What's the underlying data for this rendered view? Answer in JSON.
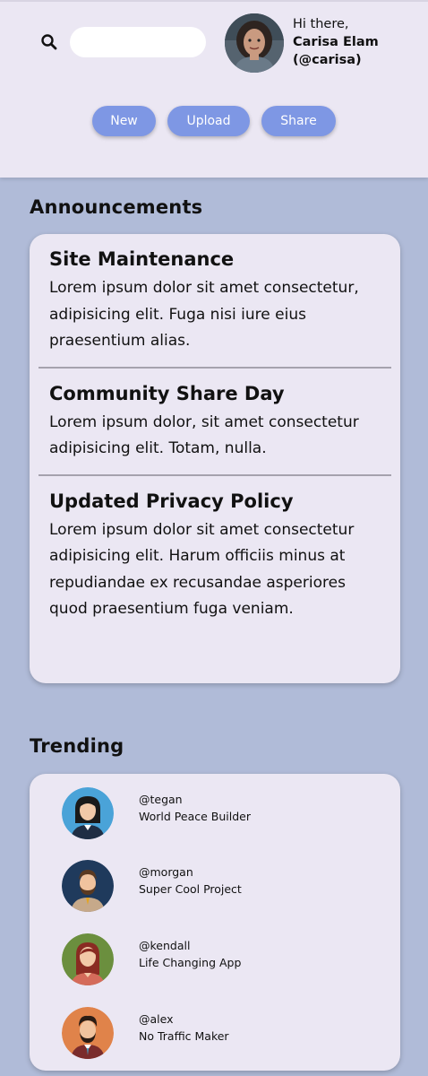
{
  "header": {
    "search": {
      "placeholder": "",
      "value": "",
      "icon": "search-icon"
    },
    "greeting_line": "Hi there,",
    "user_name": "Carisa Elam",
    "user_handle": "(@carisa)",
    "actions": {
      "new_label": "New",
      "upload_label": "Upload",
      "share_label": "Share"
    }
  },
  "announcements": {
    "title": "Announcements",
    "items": [
      {
        "title": "Site Maintenance",
        "body": "Lorem ipsum dolor sit amet consectetur, adipisicing elit. Fuga nisi iure eius praesentium alias."
      },
      {
        "title": "Community Share Day",
        "body": "Lorem ipsum dolor, sit amet consectetur adipisicing elit. Totam, nulla."
      },
      {
        "title": "Updated Privacy Policy",
        "body": "Lorem ipsum dolor sit amet consectetur adipisicing elit. Harum officiis minus at repudiandae ex recusandae asperiores quod praesentium fuga veniam."
      }
    ]
  },
  "trending": {
    "title": "Trending",
    "items": [
      {
        "handle": "@tegan",
        "project": "World Peace Builder",
        "avatar_bg": "#4aa3d8"
      },
      {
        "handle": "@morgan",
        "project": "Super Cool Project",
        "avatar_bg": "#1f3a5c"
      },
      {
        "handle": "@kendall",
        "project": "Life Changing App",
        "avatar_bg": "#6b8f3e"
      },
      {
        "handle": "@alex",
        "project": "No Traffic Maker",
        "avatar_bg": "#e0834a"
      }
    ]
  },
  "colors": {
    "page_bg": "#b0bbd8",
    "header_bg": "#ebe7f3",
    "card_bg": "#ebe7f3",
    "button_bg": "#7e97e4"
  }
}
